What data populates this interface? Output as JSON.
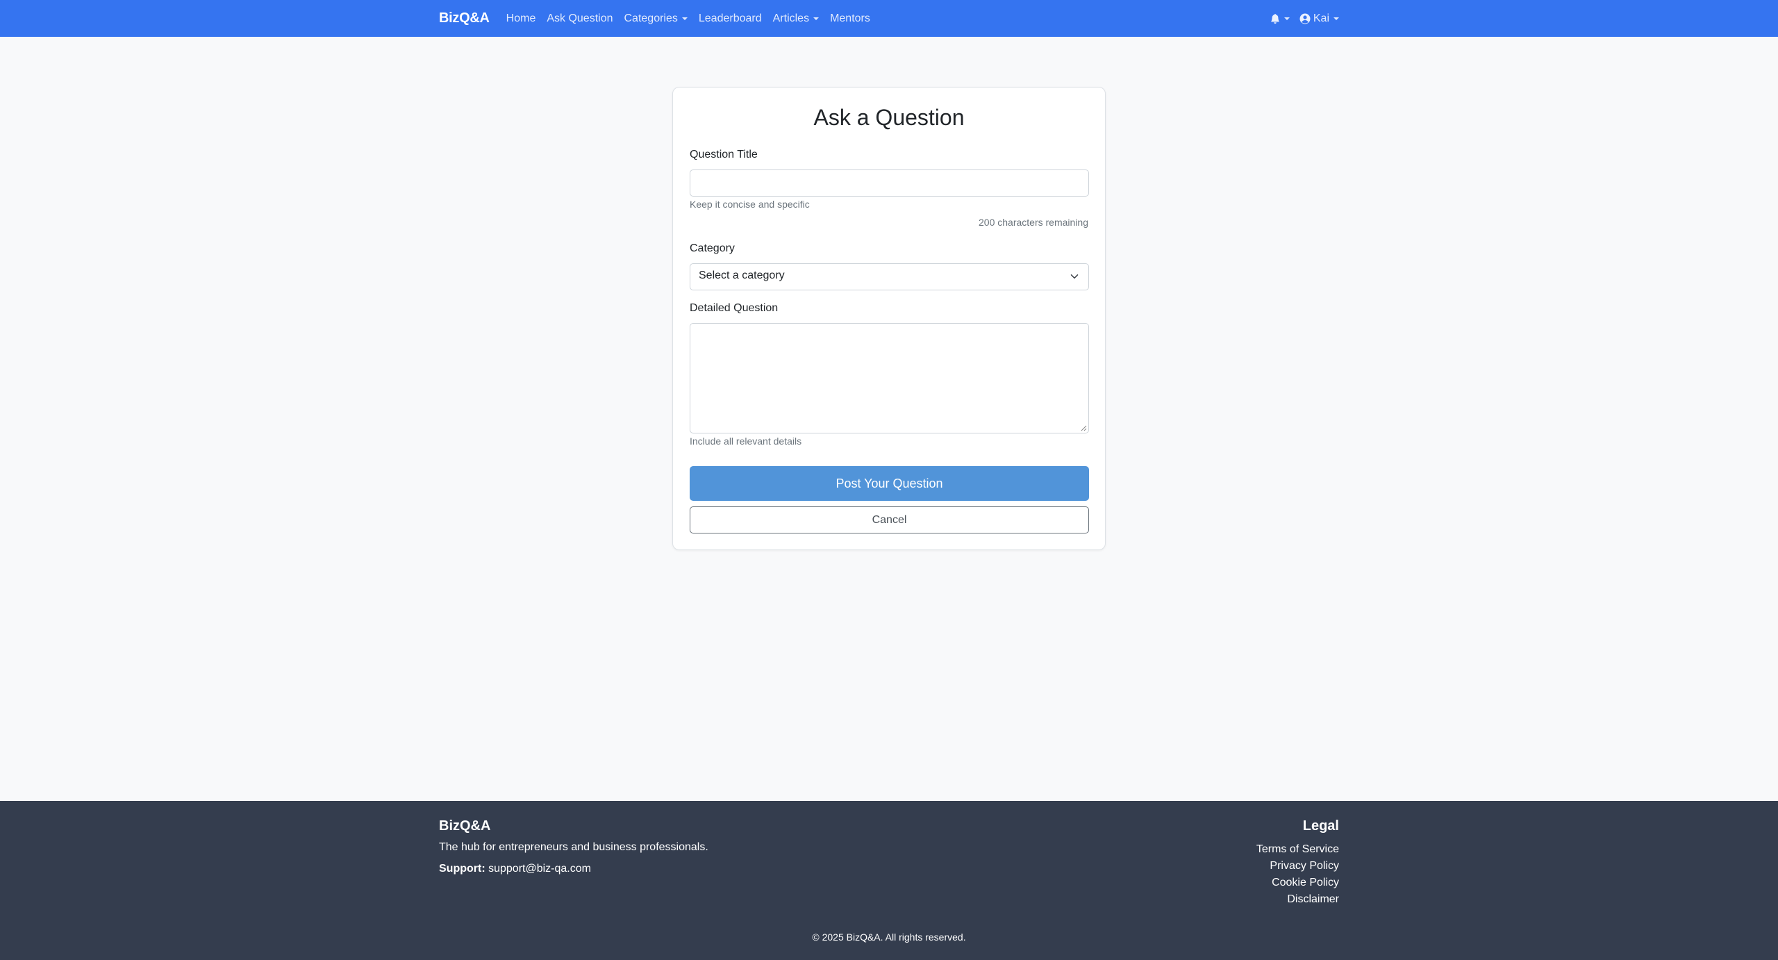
{
  "nav": {
    "brand": "BizQ&A",
    "links": [
      {
        "label": "Home"
      },
      {
        "label": "Ask Question"
      },
      {
        "label": "Categories"
      },
      {
        "label": "Leaderboard"
      },
      {
        "label": "Articles"
      },
      {
        "label": "Mentors"
      }
    ],
    "user": "Kai",
    "icons": [
      "bell-icon",
      "user-circle-icon",
      "caret-down-icon"
    ]
  },
  "form": {
    "title": "Ask a Question",
    "question_title_label": "Question Title",
    "question_title_value": "",
    "question_title_help": "Keep it concise and specific",
    "counter": "200 characters remaining",
    "category_label": "Category",
    "category_selected": "Select a category",
    "detail_label": "Detailed Question",
    "detail_value": "",
    "detail_help": "Include all relevant details",
    "submit_label": "Post Your Question",
    "cancel_label": "Cancel"
  },
  "footer": {
    "brand": "BizQ&A",
    "tagline": "The hub for entrepreneurs and business professionals.",
    "support_label": "Support:",
    "support_email": "support@biz-qa.com",
    "legal_heading": "Legal",
    "legal_links": [
      "Terms of Service",
      "Privacy Policy",
      "Cookie Policy",
      "Disclaimer"
    ],
    "copyright": "© 2025 BizQ&A. All rights reserved."
  },
  "colors": {
    "navbar": "#3574f0",
    "primary_button": "#5194d9",
    "footer": "#343d4e",
    "page_background": "#f8f9fa"
  }
}
